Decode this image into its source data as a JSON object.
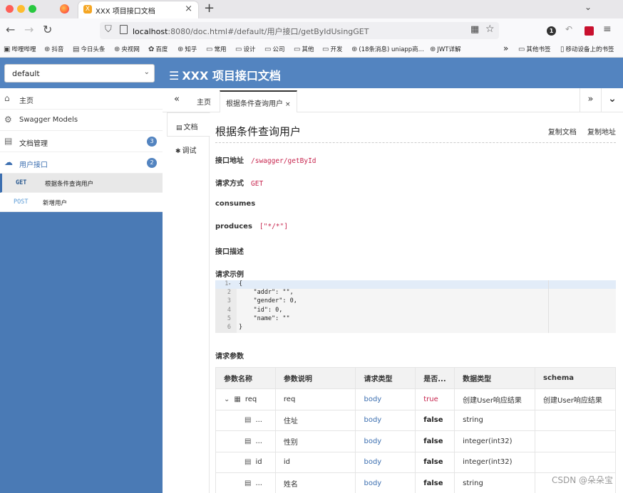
{
  "browser": {
    "tab_title": "XXX 项目接口文档",
    "tab_close": "×",
    "new_tab": "+",
    "tab_favicon": "X",
    "url_host": "localhost",
    "url_rest": ":8080/doc.html#/default/用户接口/getByIdUsingGET",
    "nav": {
      "back": "←",
      "forward": "→",
      "reload": "↻"
    },
    "icons": {
      "shield": "⛉",
      "qr": "▦",
      "star": "☆",
      "badge": "1",
      "undo": "↶",
      "menu": "≡",
      "tab_list": "⌄"
    },
    "bookmarks": [
      {
        "label": "哔哩哔哩",
        "icon": "▣"
      },
      {
        "label": "抖音",
        "icon": "⊕"
      },
      {
        "label": "今日头条",
        "icon": "▤"
      },
      {
        "label": "央视网",
        "icon": "⊕"
      },
      {
        "label": "百度",
        "icon": "✿"
      },
      {
        "label": "知乎",
        "icon": "⊕"
      },
      {
        "label": "常用",
        "icon": "▭"
      },
      {
        "label": "设计",
        "icon": "▭"
      },
      {
        "label": "公司",
        "icon": "▭"
      },
      {
        "label": "其他",
        "icon": "▭"
      },
      {
        "label": "开发",
        "icon": "▭"
      },
      {
        "label": "(18条消息) uniapp商...",
        "icon": "⊕"
      },
      {
        "label": "JWT详解",
        "icon": "⊕"
      }
    ],
    "bookmarks_more": "»",
    "bookmarks_right": [
      {
        "label": "其他书签",
        "icon": "▭"
      },
      {
        "label": "移动设备上的书签",
        "icon": "▯"
      }
    ]
  },
  "app": {
    "group_select": "default",
    "select_caret": "⌄",
    "title_icon": "☰",
    "title": "XXX 项目接口文档"
  },
  "sidebar": {
    "items": [
      {
        "label": "主页",
        "icon": "⌂"
      },
      {
        "label": "Swagger Models",
        "icon": "⚙"
      },
      {
        "label": "文档管理",
        "icon": "▤",
        "count": "3"
      },
      {
        "label": "用户接口",
        "icon": "☁",
        "count": "2"
      }
    ],
    "endpoints": [
      {
        "method": "GET",
        "label": "根据条件查询用户"
      },
      {
        "method": "POST",
        "label": "新增用户"
      }
    ]
  },
  "main": {
    "tabs_left": "«",
    "tab_home": "主页",
    "tab_active": "根据条件查询用户",
    "tab_close": "×",
    "tabs_right": "»",
    "tabs_collapse": "⌄",
    "vtab_doc": "文档",
    "vtab_doc_icon": "▤",
    "vtab_debug": "调试",
    "vtab_debug_icon": "✱"
  },
  "doc": {
    "title": "根据条件查询用户",
    "copy_doc": "复制文档",
    "copy_addr": "复制地址",
    "addr_label": "接口地址",
    "addr_value": "/swagger/getById",
    "method_label": "请求方式",
    "method_value": "GET",
    "consumes_label": "consumes",
    "produces_label": "produces",
    "produces_value": "[\"*/*\"]",
    "desc_label": "接口描述",
    "example_label": "请求示例",
    "params_label": "请求参数",
    "code_lines": [
      {
        "n": "1",
        "fold": "▾",
        "text": "{"
      },
      {
        "n": "2",
        "text": "    \"addr\": \"\","
      },
      {
        "n": "3",
        "text": "    \"gender\": 0,"
      },
      {
        "n": "4",
        "text": "    \"id\": 0,"
      },
      {
        "n": "5",
        "text": "    \"name\": \"\""
      },
      {
        "n": "6",
        "text": "}"
      }
    ],
    "table": {
      "headers": [
        "参数名称",
        "参数说明",
        "请求类型",
        "是否...",
        "数据类型",
        "schema"
      ],
      "rows": [
        {
          "name": "req",
          "expand": "⌄",
          "icon": "▦",
          "desc": "req",
          "type": "body",
          "required": "true",
          "dtype": "创建User响应结果",
          "schema": "创建User响应结果"
        },
        {
          "name": "...",
          "icon": "▤",
          "desc": "住址",
          "type": "body",
          "required": "false",
          "dtype": "string",
          "schema": ""
        },
        {
          "name": "...",
          "icon": "▤",
          "desc": "性别",
          "type": "body",
          "required": "false",
          "dtype": "integer(int32)",
          "schema": ""
        },
        {
          "name": "id",
          "icon": "▤",
          "desc": "id",
          "type": "body",
          "required": "false",
          "dtype": "integer(int32)",
          "schema": ""
        },
        {
          "name": "...",
          "icon": "▤",
          "desc": "姓名",
          "type": "body",
          "required": "false",
          "dtype": "string",
          "schema": ""
        }
      ]
    }
  },
  "watermark": "CSDN @朵朵宝"
}
